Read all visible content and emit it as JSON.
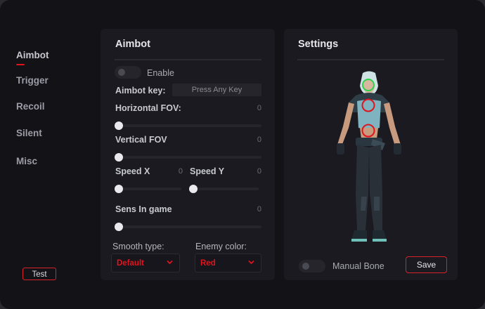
{
  "sidebar": {
    "items": [
      {
        "label": "Aimbot",
        "active": true
      },
      {
        "label": "Trigger",
        "active": false
      },
      {
        "label": "Recoil",
        "active": false
      },
      {
        "label": "Silent",
        "active": false
      },
      {
        "label": "Misc",
        "active": false
      }
    ],
    "test_button": "Test"
  },
  "aimbot": {
    "title": "Aimbot",
    "enable_label": "Enable",
    "enable_on": false,
    "key_label": "Aimbot key:",
    "key_value": "Press Any Key",
    "hfov_label": "Horizontal FOV:",
    "hfov_value": "0",
    "vfov_label": "Vertical FOV",
    "vfov_value": "0",
    "speedx_label": "Speed X",
    "speedx_value": "0",
    "speedy_label": "Speed Y",
    "speedy_value": "0",
    "sens_label": "Sens In game",
    "sens_value": "0",
    "smooth_label": "Smooth type:",
    "smooth_value": "Default",
    "enemy_color_label": "Enemy color:",
    "enemy_color_value": "Red"
  },
  "settings": {
    "title": "Settings",
    "manual_bone_label": "Manual Bone",
    "manual_bone_on": false,
    "save_button": "Save"
  },
  "colors": {
    "accent": "#e0141e",
    "background": "#131217",
    "panel": "#1a1a20"
  }
}
